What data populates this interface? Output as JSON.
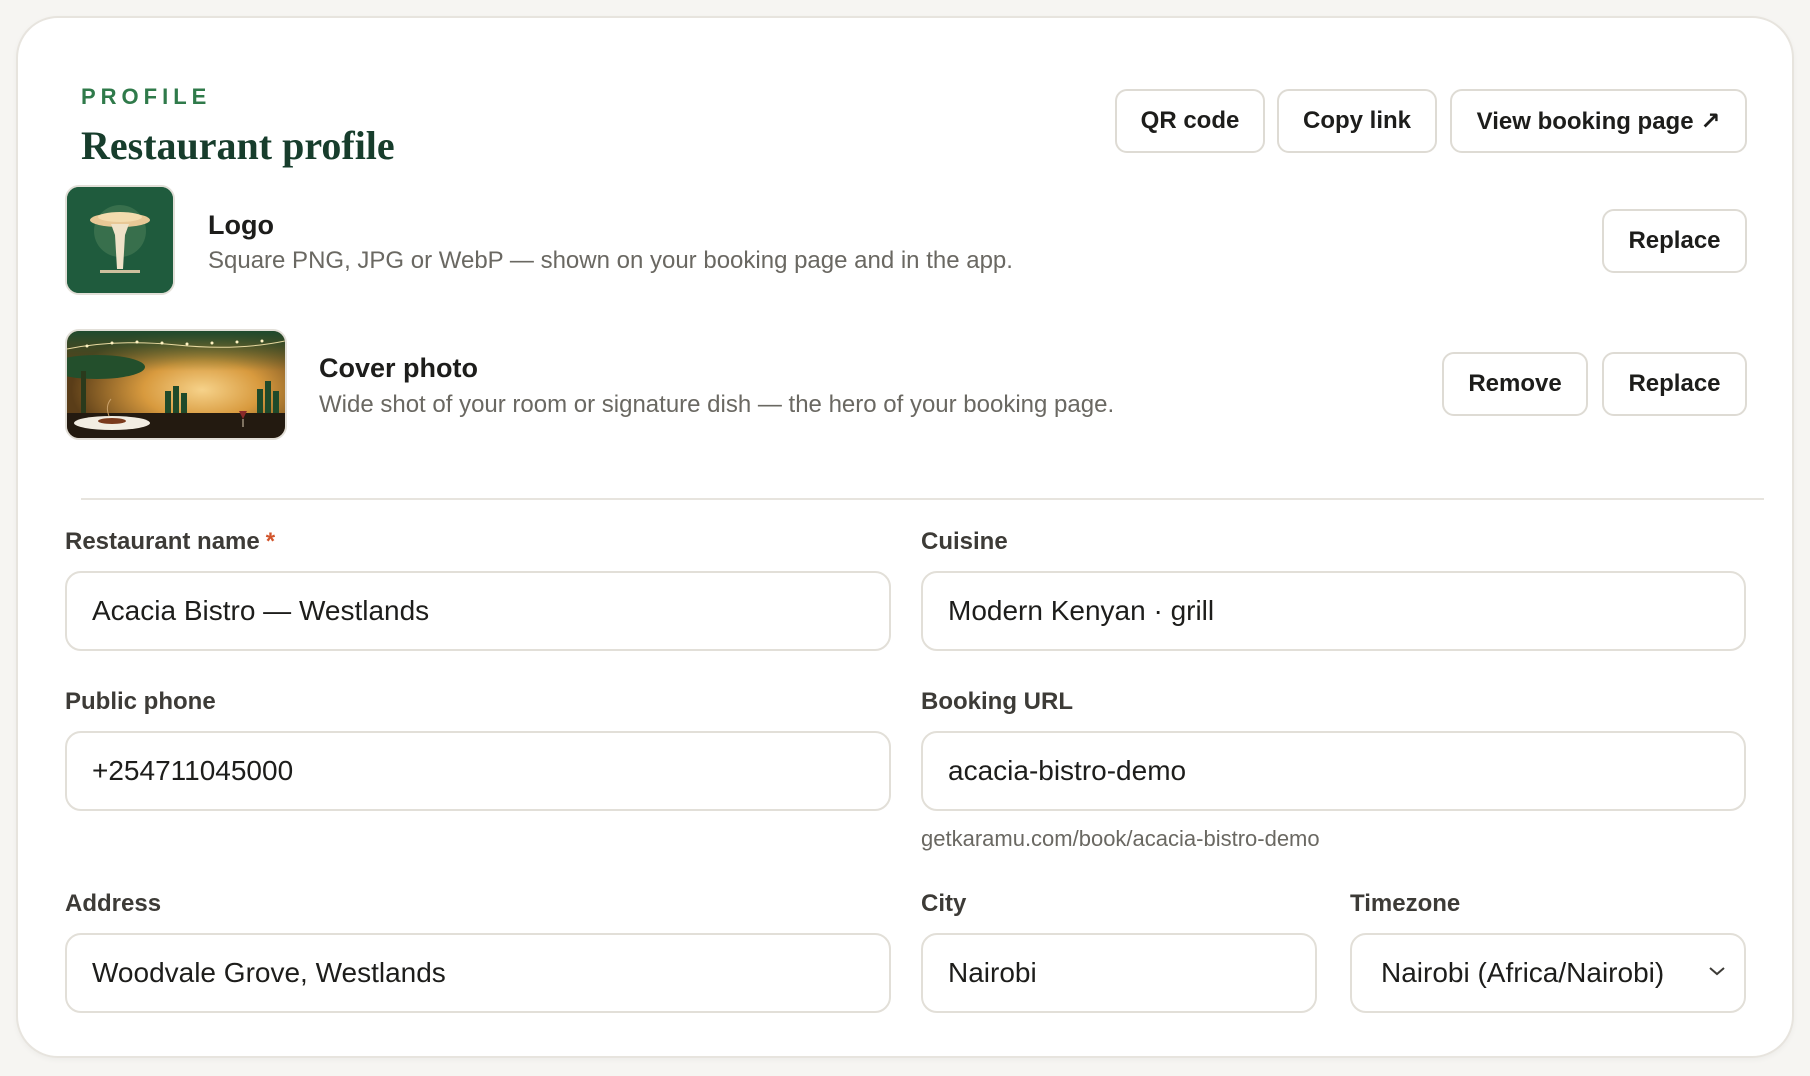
{
  "header": {
    "eyebrow": "PROFILE",
    "title": "Restaurant profile",
    "actions": {
      "qr_code": "QR code",
      "copy_link": "Copy link",
      "view_booking_page": "View booking page ↗"
    }
  },
  "logo": {
    "title": "Logo",
    "description": "Square PNG, JPG or WebP — shown on your booking page and in the app.",
    "replace_label": "Replace",
    "icon": "table-lamp-icon"
  },
  "cover_photo": {
    "title": "Cover photo",
    "description": "Wide shot of your room or signature dish — the hero of your booking page.",
    "remove_label": "Remove",
    "replace_label": "Replace"
  },
  "form": {
    "restaurant_name": {
      "label": "Restaurant name",
      "required_mark": "*",
      "value": "Acacia Bistro — Westlands"
    },
    "cuisine": {
      "label": "Cuisine",
      "value": "Modern Kenyan · grill"
    },
    "public_phone": {
      "label": "Public phone",
      "value": "+254711045000"
    },
    "booking_url": {
      "label": "Booking URL",
      "value": "acacia-bistro-demo",
      "helper": "getkaramu.com/book/acacia-bistro-demo"
    },
    "address": {
      "label": "Address",
      "value": "Woodvale Grove, Westlands"
    },
    "city": {
      "label": "City",
      "value": "Nairobi"
    },
    "timezone": {
      "label": "Timezone",
      "value": "Nairobi (Africa/Nairobi)"
    }
  },
  "colors": {
    "accent_green": "#2f7a4a",
    "title_green": "#173d2c",
    "required_red": "#d2552c"
  }
}
